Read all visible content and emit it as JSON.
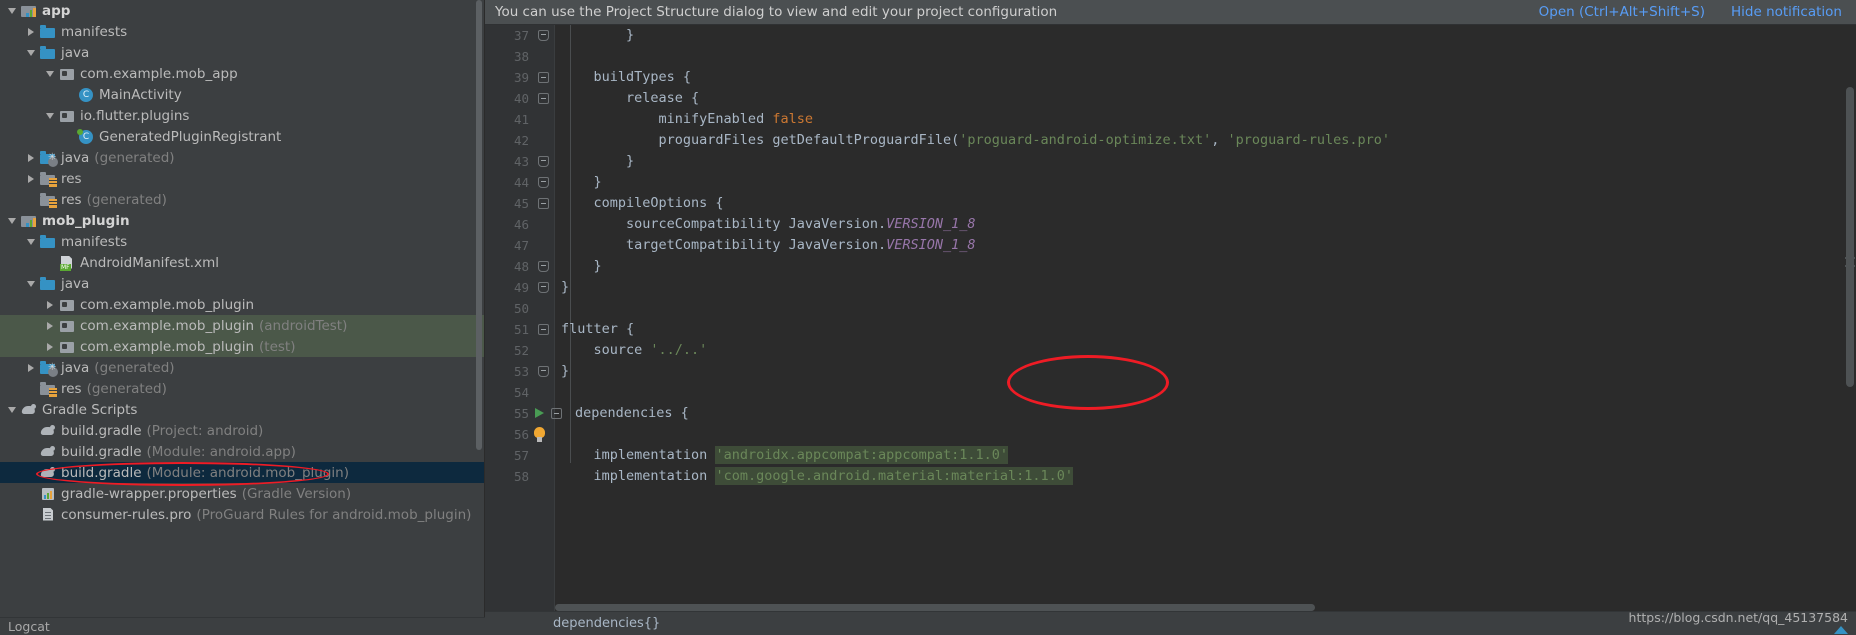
{
  "sidebar": {
    "scroll_visible": true,
    "bottom_tab": "Logcat",
    "tree": [
      {
        "indent": 0,
        "arrow": "open",
        "icon": "module-icon",
        "label": "app",
        "sub": "",
        "bold": true,
        "state": ""
      },
      {
        "indent": 1,
        "arrow": "closed",
        "icon": "folder-icon",
        "label": "manifests",
        "sub": "",
        "bold": false,
        "state": ""
      },
      {
        "indent": 1,
        "arrow": "open",
        "icon": "folder-icon",
        "label": "java",
        "sub": "",
        "bold": false,
        "state": ""
      },
      {
        "indent": 2,
        "arrow": "open",
        "icon": "package-icon",
        "label": "com.example.mob_app",
        "sub": "",
        "bold": false,
        "state": ""
      },
      {
        "indent": 3,
        "arrow": "none",
        "icon": "class-icon",
        "label": "MainActivity",
        "sub": "",
        "bold": false,
        "state": ""
      },
      {
        "indent": 2,
        "arrow": "open",
        "icon": "package-icon",
        "label": "io.flutter.plugins",
        "sub": "",
        "bold": false,
        "state": ""
      },
      {
        "indent": 3,
        "arrow": "none",
        "icon": "class-gen-icon",
        "label": "GeneratedPluginRegistrant",
        "sub": "",
        "bold": false,
        "state": ""
      },
      {
        "indent": 1,
        "arrow": "closed",
        "icon": "folder-gen-icon",
        "label": "java",
        "sub": "(generated)",
        "bold": false,
        "state": ""
      },
      {
        "indent": 1,
        "arrow": "closed",
        "icon": "res-folder-icon",
        "label": "res",
        "sub": "",
        "bold": false,
        "state": ""
      },
      {
        "indent": 1,
        "arrow": "none",
        "icon": "res-folder-icon",
        "label": "res",
        "sub": "(generated)",
        "bold": false,
        "state": ""
      },
      {
        "indent": 0,
        "arrow": "open",
        "icon": "module-icon",
        "label": "mob_plugin",
        "sub": "",
        "bold": true,
        "state": ""
      },
      {
        "indent": 1,
        "arrow": "open",
        "icon": "folder-icon",
        "label": "manifests",
        "sub": "",
        "bold": false,
        "state": ""
      },
      {
        "indent": 2,
        "arrow": "none",
        "icon": "manifest-xml-icon",
        "label": "AndroidManifest.xml",
        "sub": "",
        "bold": false,
        "state": ""
      },
      {
        "indent": 1,
        "arrow": "open",
        "icon": "folder-icon",
        "label": "java",
        "sub": "",
        "bold": false,
        "state": ""
      },
      {
        "indent": 2,
        "arrow": "closed",
        "icon": "package-icon",
        "label": "com.example.mob_plugin",
        "sub": "",
        "bold": false,
        "state": ""
      },
      {
        "indent": 2,
        "arrow": "closed",
        "icon": "package-icon",
        "label": "com.example.mob_plugin",
        "sub": "(androidTest)",
        "bold": false,
        "state": "selected-green"
      },
      {
        "indent": 2,
        "arrow": "closed",
        "icon": "package-icon",
        "label": "com.example.mob_plugin",
        "sub": "(test)",
        "bold": false,
        "state": "selected-green"
      },
      {
        "indent": 1,
        "arrow": "closed",
        "icon": "folder-gen-icon",
        "label": "java",
        "sub": "(generated)",
        "bold": false,
        "state": ""
      },
      {
        "indent": 1,
        "arrow": "none",
        "icon": "res-folder-icon",
        "label": "res",
        "sub": "(generated)",
        "bold": false,
        "state": ""
      },
      {
        "indent": 0,
        "arrow": "open",
        "icon": "gradle-icon",
        "label": "Gradle Scripts",
        "sub": "",
        "bold": false,
        "state": ""
      },
      {
        "indent": 1,
        "arrow": "none",
        "icon": "gradle-icon",
        "label": "build.gradle",
        "sub": "(Project: android)",
        "bold": false,
        "state": ""
      },
      {
        "indent": 1,
        "arrow": "none",
        "icon": "gradle-icon",
        "label": "build.gradle",
        "sub": "(Module: android.app)",
        "bold": false,
        "state": ""
      },
      {
        "indent": 1,
        "arrow": "none",
        "icon": "gradle-icon",
        "label": "build.gradle",
        "sub": "(Module: android.mob_plugin)",
        "bold": false,
        "state": "selected-blue"
      },
      {
        "indent": 1,
        "arrow": "none",
        "icon": "properties-icon",
        "label": "gradle-wrapper.properties",
        "sub": "(Gradle Version)",
        "bold": false,
        "state": ""
      },
      {
        "indent": 1,
        "arrow": "none",
        "icon": "file-icon",
        "label": "consumer-rules.pro",
        "sub": "(ProGuard Rules for android.mob_plugin)",
        "bold": false,
        "state": ""
      }
    ]
  },
  "notification": {
    "message": "You can use the Project Structure dialog to view and edit your project configuration",
    "open_link": "Open (Ctrl+Alt+Shift+S)",
    "hide_link": "Hide notification"
  },
  "editor": {
    "lines": [
      {
        "num": "37",
        "gutter": "fold-bottom",
        "tokens": [
          {
            "t": "        }",
            "c": "plain"
          }
        ]
      },
      {
        "num": "38",
        "gutter": "",
        "tokens": [
          {
            "t": "",
            "c": "plain"
          }
        ]
      },
      {
        "num": "39",
        "gutter": "fold-top",
        "tokens": [
          {
            "t": "    buildTypes {",
            "c": "plain"
          }
        ]
      },
      {
        "num": "40",
        "gutter": "fold-top",
        "tokens": [
          {
            "t": "        release {",
            "c": "plain"
          }
        ]
      },
      {
        "num": "41",
        "gutter": "",
        "tokens": [
          {
            "t": "            minifyEnabled ",
            "c": "plain"
          },
          {
            "t": "false",
            "c": "kw"
          }
        ]
      },
      {
        "num": "42",
        "gutter": "",
        "tokens": [
          {
            "t": "            proguardFiles getDefaultProguardFile(",
            "c": "plain"
          },
          {
            "t": "'proguard-android-optimize.txt'",
            "c": "str"
          },
          {
            "t": ", ",
            "c": "plain"
          },
          {
            "t": "'proguard-rules.pro'",
            "c": "str"
          }
        ]
      },
      {
        "num": "43",
        "gutter": "fold-bottom",
        "tokens": [
          {
            "t": "        }",
            "c": "plain"
          }
        ]
      },
      {
        "num": "44",
        "gutter": "fold-bottom",
        "tokens": [
          {
            "t": "    }",
            "c": "plain"
          }
        ]
      },
      {
        "num": "45",
        "gutter": "fold-top",
        "tokens": [
          {
            "t": "    compileOptions {",
            "c": "plain"
          }
        ]
      },
      {
        "num": "46",
        "gutter": "",
        "tokens": [
          {
            "t": "        sourceCompatibility JavaVersion.",
            "c": "plain"
          },
          {
            "t": "VERSION_1_8",
            "c": "fld"
          }
        ]
      },
      {
        "num": "47",
        "gutter": "",
        "tokens": [
          {
            "t": "        targetCompatibility JavaVersion.",
            "c": "plain"
          },
          {
            "t": "VERSION_1_8",
            "c": "fld"
          }
        ]
      },
      {
        "num": "48",
        "gutter": "fold-bottom",
        "tokens": [
          {
            "t": "    }",
            "c": "plain"
          }
        ]
      },
      {
        "num": "49",
        "gutter": "fold-bottom",
        "tokens": [
          {
            "t": "}",
            "c": "plain"
          }
        ]
      },
      {
        "num": "50",
        "gutter": "",
        "tokens": [
          {
            "t": "",
            "c": "plain"
          }
        ]
      },
      {
        "num": "51",
        "gutter": "fold-top",
        "tokens": [
          {
            "t": "flutter {",
            "c": "plain"
          }
        ]
      },
      {
        "num": "52",
        "gutter": "",
        "tokens": [
          {
            "t": "    source ",
            "c": "plain"
          },
          {
            "t": "'../..'",
            "c": "str"
          }
        ]
      },
      {
        "num": "53",
        "gutter": "fold-bottom",
        "tokens": [
          {
            "t": "}",
            "c": "plain"
          }
        ]
      },
      {
        "num": "54",
        "gutter": "",
        "tokens": [
          {
            "t": "",
            "c": "plain"
          }
        ]
      },
      {
        "num": "55",
        "gutter": "run-fold-top",
        "tokens": [
          {
            "t": "dependencies {",
            "c": "plain"
          }
        ]
      },
      {
        "num": "56",
        "gutter": "bulb",
        "tokens": [
          {
            "t": "",
            "c": "plain"
          }
        ]
      },
      {
        "num": "57",
        "gutter": "",
        "tokens": [
          {
            "t": "    implementation ",
            "c": "plain"
          },
          {
            "t": "'androidx.appcompat:appcompat:1.1.0'",
            "c": "dep-hl"
          }
        ]
      },
      {
        "num": "58",
        "gutter": "",
        "tokens": [
          {
            "t": "    implementation ",
            "c": "plain"
          },
          {
            "t": "'com.google.android.material:material:1.1.0'",
            "c": "dep-hl"
          }
        ]
      }
    ],
    "breadcrumb": "dependencies{}",
    "watermark": "https://blog.csdn.net/qq_45137584"
  },
  "annotations": {
    "ellipse_code_label": "red-ellipse-flutter-source",
    "ellipse_tree_label": "red-ellipse-build-gradle-module"
  },
  "colors": {
    "accent_link": "#589df6",
    "annotation_red": "#ee1c25",
    "selection_blue": "#0d293e",
    "selection_green": "#4b5849",
    "editor_bg": "#2b2b2b",
    "sidebar_bg": "#3c3f41",
    "string_green": "#6a8759",
    "keyword_orange": "#cc7832",
    "field_purple": "#9876aa"
  }
}
